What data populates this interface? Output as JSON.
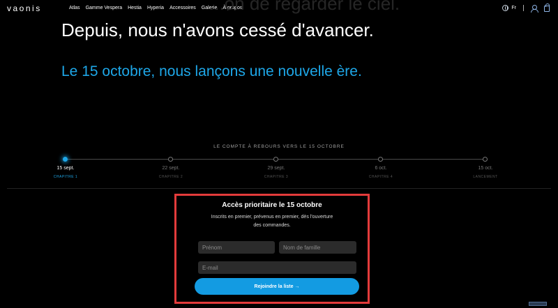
{
  "header": {
    "logo": "vaonis",
    "nav": [
      "Atlas",
      "Gamme Vespera",
      "Hestia",
      "Hyperia",
      "Accessoires",
      "Galerie",
      "À propos"
    ],
    "lang": "Fr"
  },
  "hero": {
    "ghost_text": "...on de regarder le ciel.",
    "headline": "Depuis, nous n'avons cessé d'avancer.",
    "subline": "Le 15 octobre, nous lançons une nouvelle ère."
  },
  "countdown": {
    "title": "LE COMPTE À REBOURS VERS LE 15 OCTOBRE",
    "steps": [
      {
        "date": "15 sept.",
        "chapter": "CHAPITRE 1"
      },
      {
        "date": "22 sept.",
        "chapter": "CHAPITRE 2"
      },
      {
        "date": "29 sept.",
        "chapter": "CHAPITRE 3"
      },
      {
        "date": "6 oct.",
        "chapter": "CHAPITRE 4"
      },
      {
        "date": "15 oct.",
        "chapter": "LANCEMENT"
      }
    ]
  },
  "signup": {
    "title": "Accès prioritaire le 15 octobre",
    "description": "Inscrits en premier, prévenus en premier, dès l'ouverture des commandes.",
    "first_name_placeholder": "Prénom",
    "last_name_placeholder": "Nom de famille",
    "email_placeholder": "E-mail",
    "submit_label": "Rejoindre la liste →"
  },
  "colors": {
    "accent": "#1ea7e8",
    "highlight_border": "#e33b3b",
    "background": "#000000"
  }
}
